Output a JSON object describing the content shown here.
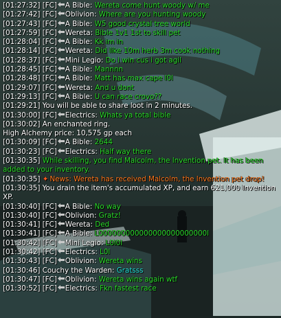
{
  "colors": {
    "timestamp": "#ffffff",
    "speaker": "#ffffff",
    "chat_text": "#2bdc2b",
    "system_text": "#ffffff",
    "news_text": "#ff7a1f",
    "player_name": "#22e0d8"
  },
  "icons": {
    "rank": "clan-rank-icon",
    "news": "news-star-icon"
  },
  "chat": [
    {
      "ts": "[01:27:32]",
      "clan": "[FC]",
      "icon": true,
      "speaker": "A Bible:",
      "text": "Wereta  come hunt woody w/ me",
      "color": "green"
    },
    {
      "ts": "[01:27:42]",
      "clan": "[FC]",
      "icon": true,
      "speaker": "Oblivion:",
      "text": "Where are you hunting woody",
      "color": "green"
    },
    {
      "ts": "[01:27:43]",
      "clan": "[FC]",
      "icon": true,
      "speaker": "A Bible:",
      "text": "W5 good crystal tree world",
      "color": "green"
    },
    {
      "ts": "[01:27:59]",
      "clan": "[FC]",
      "icon": true,
      "speaker": "Wereta:",
      "text": "Bible 1v1 1st to skill pet",
      "color": "green"
    },
    {
      "ts": "[01:28:04]",
      "clan": "[FC]",
      "icon": true,
      "speaker": "A Bible:",
      "text": "Kk im in",
      "color": "green"
    },
    {
      "ts": "[01:28:14]",
      "clan": "[FC]",
      "icon": true,
      "speaker": "Wereta:",
      "text": "Did like 10m herb 3m cook nothing",
      "color": "green"
    },
    {
      "ts": "[01:28:37]",
      "clan": "[FC]",
      "icon": true,
      "speaker": "Mini Legio:",
      "text": "Do i win cus i got agil",
      "color": "green"
    },
    {
      "ts": "[01:28:45]",
      "clan": "[FC]",
      "icon": true,
      "speaker": "A Bible:",
      "text": "Mannnn",
      "color": "green"
    },
    {
      "ts": "[01:28:48]",
      "clan": "[FC]",
      "icon": true,
      "speaker": "A Bible:",
      "text": "Matt has max cape l0l",
      "color": "green"
    },
    {
      "ts": "[01:29:07]",
      "clan": "[FC]",
      "icon": true,
      "speaker": "Wereta:",
      "text": "And u dont",
      "color": "green"
    },
    {
      "ts": "[01:29:13]",
      "clan": "[FC]",
      "icon": true,
      "speaker": "A Bible:",
      "text": "U can race crovo??",
      "color": "green"
    },
    {
      "ts": "[01:29:21]",
      "text": "You will be able to share loot in 2 minutes.",
      "color": "white"
    },
    {
      "ts": "[01:30:00]",
      "clan": "[FC]",
      "icon": true,
      "speaker": "Electrics:",
      "text": "Whats ya total bible",
      "color": "green"
    },
    {
      "ts": "[01:30:02]",
      "text": "An enchanted ring.",
      "color": "white"
    },
    {
      "text": "High Alchemy price: 10,575 gp each",
      "color": "white"
    },
    {
      "ts": "[01:30:09]",
      "clan": "[FC]",
      "icon": true,
      "speaker": "A Bible:",
      "text": "2644",
      "color": "green"
    },
    {
      "ts": "[01:30:23]",
      "clan": "[FC]",
      "icon": true,
      "speaker": "Electrics:",
      "text": "Half way there",
      "color": "green"
    },
    {
      "ts": "[01:30:35]",
      "text": "While skilling, you find Malcolm, the Invention pet. It has been added to your inventory.",
      "color": "green",
      "wrap": true
    },
    {
      "ts": "[01:30:35]",
      "news": true,
      "text": "News: Wereta has received Malcolm, the Invention pet drop!",
      "color": "orange",
      "wrap": true
    },
    {
      "ts": "[01:30:35]",
      "text": "You drain the item's accumulated XP, and earn 621,000 Invention XP.",
      "color": "white",
      "wrap": true
    },
    {
      "ts": "[01:30:40]",
      "clan": "[FC]",
      "icon": true,
      "speaker": "A Bible:",
      "text": "No way",
      "color": "green"
    },
    {
      "ts": "[01:30:40]",
      "clan": "[FC]",
      "icon": true,
      "speaker": "Oblivion:",
      "text": "Gratz!",
      "color": "green"
    },
    {
      "ts": "[01:30:41]",
      "clan": "[FC]",
      "icon": true,
      "speaker": "Wereta:",
      "text": "Ded",
      "color": "green"
    },
    {
      "ts": "[01:30:41]",
      "clan": "[FC]",
      "icon": true,
      "speaker": "A Bible:",
      "text": "L000000000000000000000000l",
      "color": "green"
    },
    {
      "ts": "[01:30:42]",
      "clan": "[FC]",
      "icon": true,
      "speaker": "Mini Legio:",
      "text": "L0l0l",
      "color": "green"
    },
    {
      "ts": "[01:30:42]",
      "clan": "[FC]",
      "icon": true,
      "speaker": "Electrics:",
      "text": "L0l",
      "color": "green"
    },
    {
      "ts": "[01:30:43]",
      "clan": "[FC]",
      "icon": true,
      "speaker": "Oblivion:",
      "text": "Wereta wins",
      "color": "green"
    },
    {
      "ts": "[01:30:46]",
      "speaker": "Couchy the Warden:",
      "text": "Gratsss",
      "color": "cyan"
    },
    {
      "ts": "[01:30:47]",
      "clan": "[FC]",
      "icon": true,
      "speaker": "Oblivion:",
      "text": "Wereta wins again wtf",
      "color": "green"
    },
    {
      "ts": "[01:30:52]",
      "clan": "[FC]",
      "icon": true,
      "speaker": "Electrics:",
      "text": "Fkn fastest race",
      "color": "green"
    }
  ]
}
